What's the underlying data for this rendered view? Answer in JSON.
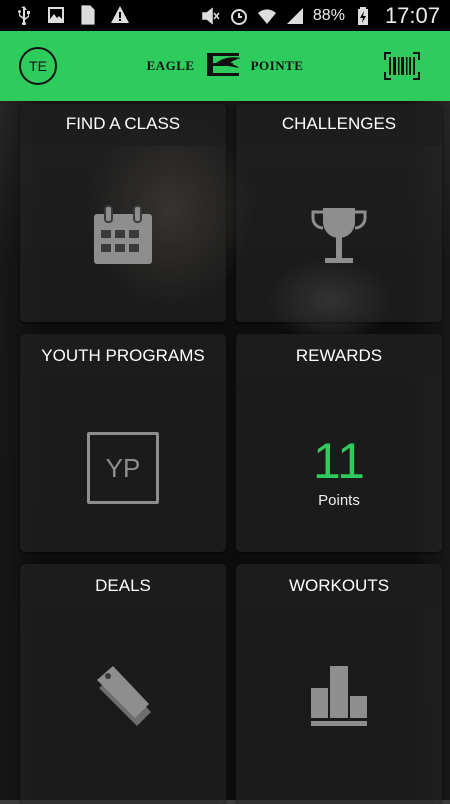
{
  "status_bar": {
    "battery_percent": "88%",
    "time": "17:07",
    "icons_left": [
      "usb-icon",
      "image-icon",
      "sim-blocked-icon",
      "warning-icon"
    ],
    "icons_right": [
      "mute-icon",
      "alarm-icon",
      "wifi-icon",
      "signal-icon",
      "battery-charging-icon"
    ]
  },
  "header": {
    "avatar_initials": "TE",
    "brand_left": "EAGLE",
    "brand_right": "POINTE",
    "accent_color": "#2ecc5c"
  },
  "tiles": [
    {
      "title": "FIND A CLASS",
      "icon": "calendar-icon"
    },
    {
      "title": "CHALLENGES",
      "icon": "trophy-icon"
    },
    {
      "title": "YOUTH PROGRAMS",
      "icon_text": "YP"
    },
    {
      "title": "REWARDS",
      "points": "11",
      "points_label": "Points"
    },
    {
      "title": "DEALS",
      "icon": "tags-icon"
    },
    {
      "title": "WORKOUTS",
      "icon": "podium-icon"
    }
  ]
}
